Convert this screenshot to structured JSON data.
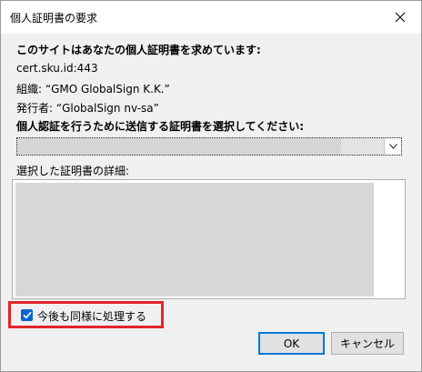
{
  "window": {
    "title": "個人証明書の要求",
    "close_icon": "close-icon"
  },
  "content": {
    "heading": "このサイトはあなたの個人証明書を求めています:",
    "host": "cert.sku.id:443",
    "organization": "組織: “GMO GlobalSign K.K.”",
    "issuer": "発行者: “GlobalSign nv-sa”",
    "select_prompt": "個人認証を行うために送信する証明書を選択してください:",
    "details_label": "選択した証明書の詳細:"
  },
  "remember": {
    "label": "今後も同様に処理する",
    "checked": true
  },
  "buttons": {
    "ok": "OK",
    "cancel": "キャンセル"
  },
  "colors": {
    "accent": "#0078d7",
    "checkbox": "#0a64d2",
    "highlight": "#e3242b"
  }
}
